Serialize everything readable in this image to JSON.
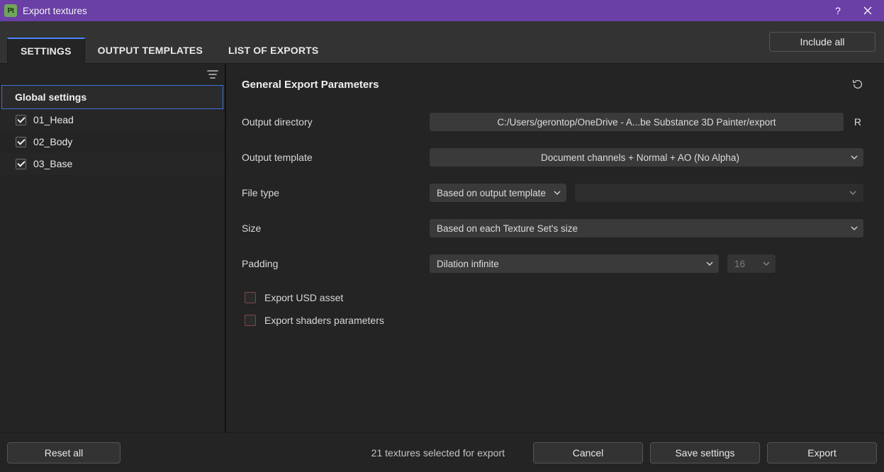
{
  "window": {
    "app_badge": "Pt",
    "title": "Export textures",
    "help": "?",
    "close": "×"
  },
  "tabs": {
    "settings": "SETTINGS",
    "output_templates": "OUTPUT TEMPLATES",
    "list_of_exports": "LIST OF EXPORTS",
    "active": "settings"
  },
  "include_all": "Include all",
  "sidebar": {
    "global": "Global settings",
    "items": [
      {
        "label": "01_Head",
        "checked": true
      },
      {
        "label": "02_Body",
        "checked": true
      },
      {
        "label": "03_Base",
        "checked": true
      }
    ]
  },
  "panel": {
    "heading": "General Export Parameters",
    "output_directory_label": "Output directory",
    "output_directory_value": "C:/Users/gerontop/OneDrive - A...be Substance 3D Painter/export",
    "output_directory_reset": "R",
    "output_template_label": "Output template",
    "output_template_value": "Document channels + Normal + AO (No Alpha)",
    "file_type_label": "File type",
    "file_type_value": "Based on output template",
    "size_label": "Size",
    "size_value": "Based on each Texture Set's size",
    "padding_label": "Padding",
    "padding_value": "Dilation infinite",
    "padding_number": "16",
    "export_usd_label": "Export USD asset",
    "export_usd_checked": false,
    "export_shaders_label": "Export shaders parameters",
    "export_shaders_checked": false
  },
  "footer": {
    "reset_all": "Reset all",
    "status": "21 textures selected for export",
    "cancel": "Cancel",
    "save_settings": "Save settings",
    "export": "Export"
  }
}
